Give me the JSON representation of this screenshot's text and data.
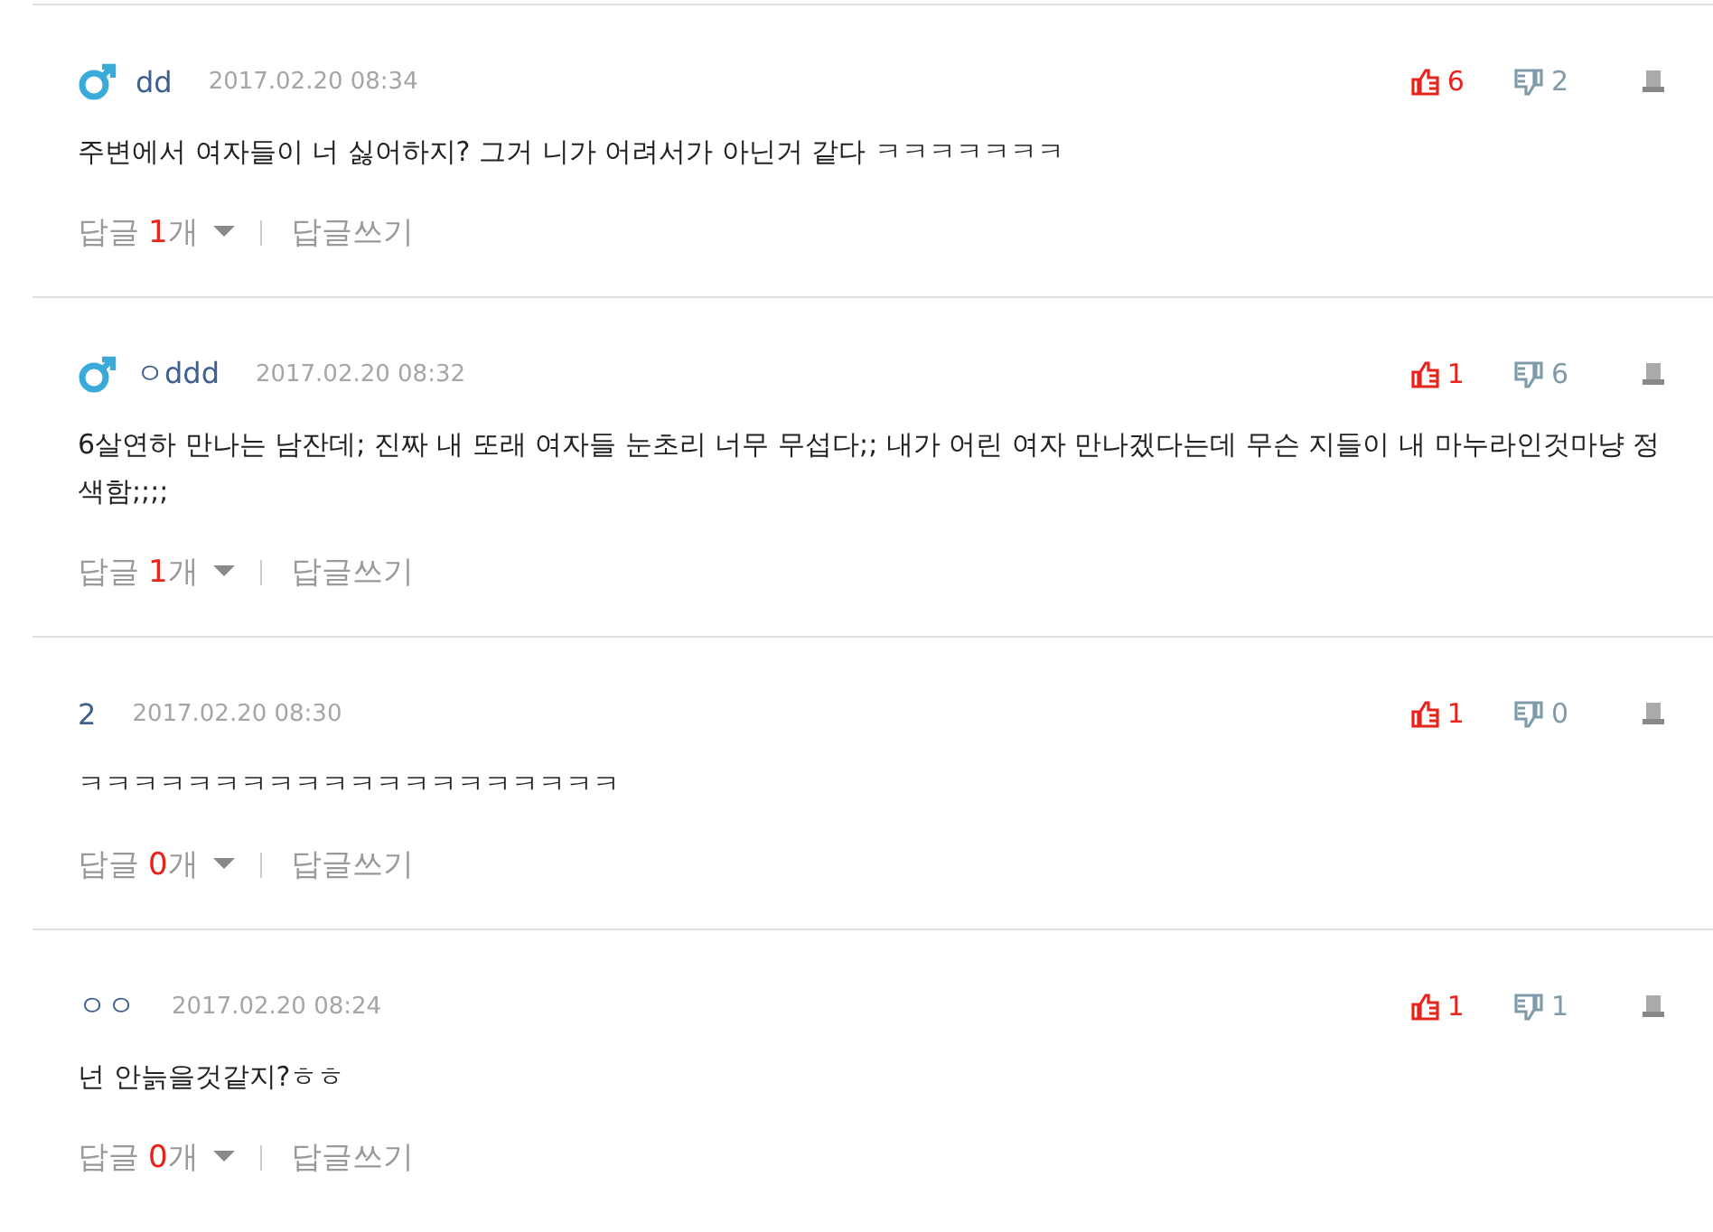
{
  "comments": [
    {
      "male_icon": true,
      "author": "dd",
      "date": "2017.02.20 08:34",
      "body": "주변에서 여자들이 너 싫어하지? 그거 니가 어려서가 아닌거 같다 ㅋㅋㅋㅋㅋㅋㅋ",
      "likes": "6",
      "dislikes": "2",
      "reply_label": "답글",
      "reply_count": "1",
      "reply_unit": "개",
      "write_label": "답글쓰기"
    },
    {
      "male_icon": true,
      "author": "ㅇddd",
      "date": "2017.02.20 08:32",
      "body": "6살연하 만나는 남잔데; 진짜 내 또래 여자들 눈초리 너무 무섭다;; 내가 어린 여자 만나겠다는데 무슨 지들이 내 마누라인것마냥 정색함;;;;",
      "likes": "1",
      "dislikes": "6",
      "reply_label": "답글",
      "reply_count": "1",
      "reply_unit": "개",
      "write_label": "답글쓰기"
    },
    {
      "male_icon": false,
      "author": "2",
      "date": "2017.02.20 08:30",
      "body": "ㅋㅋㅋㅋㅋㅋㅋㅋㅋㅋㅋㅋㅋㅋㅋㅋㅋㅋㅋㅋ",
      "likes": "1",
      "dislikes": "0",
      "reply_label": "답글",
      "reply_count": "0",
      "reply_unit": "개",
      "write_label": "답글쓰기"
    },
    {
      "male_icon": false,
      "author": "ㅇㅇ",
      "date": "2017.02.20 08:24",
      "body": "넌 안늙을것같지?ㅎㅎ",
      "likes": "1",
      "dislikes": "1",
      "reply_label": "답글",
      "reply_count": "0",
      "reply_unit": "개",
      "write_label": "답글쓰기"
    }
  ]
}
